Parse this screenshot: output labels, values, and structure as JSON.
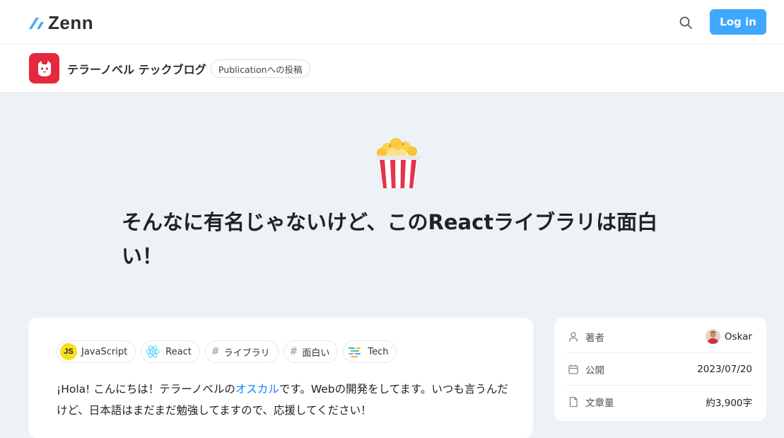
{
  "header": {
    "logo_text": "Zenn",
    "login_label": "Log in",
    "search_icon": "search-icon",
    "brand_color": "#3ea8ff"
  },
  "publication": {
    "name": "テラーノベル テックブログ",
    "badge": "Publicationへの投稿",
    "avatar_color": "#e5283e"
  },
  "article": {
    "emoji": "popcorn",
    "title": "そんなに有名じゃないけど、このReactライブラリは面白い！",
    "topics": [
      {
        "label": "JavaScript",
        "icon": "javascript-icon"
      },
      {
        "label": "React",
        "icon": "react-icon"
      },
      {
        "label": "ライブラリ",
        "icon": "hash-icon"
      },
      {
        "label": "面白い",
        "icon": "hash-icon"
      },
      {
        "label": "Tech",
        "icon": "tech-icon"
      }
    ],
    "body": {
      "part1": "¡Hola! こんにちは！テラーノベルの",
      "link": "オスカル",
      "part2": "です。Webの開発をしてます。いつも言うんだけど、日本語はまだまだ勉強してますので、応援してください！"
    }
  },
  "sidebar": {
    "author_label": "著者",
    "author_name": "Oskar",
    "published_label": "公開",
    "published_date": "2023/07/20",
    "length_label": "文章量",
    "length_value": "約3,900字"
  }
}
